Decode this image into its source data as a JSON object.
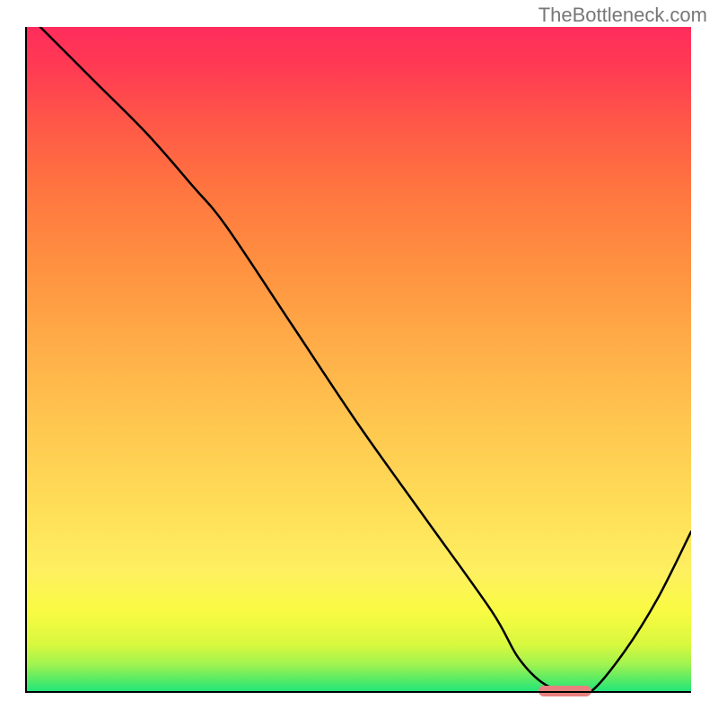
{
  "watermark": "TheBottleneck.com",
  "chart_data": {
    "type": "line",
    "title": "",
    "xlabel": "",
    "ylabel": "",
    "xlim": [
      0,
      100
    ],
    "ylim": [
      0,
      100
    ],
    "x": [
      2,
      10,
      18,
      25,
      30,
      40,
      50,
      60,
      70,
      74,
      78,
      82,
      85,
      90,
      95,
      100
    ],
    "values": [
      100,
      92,
      84,
      76,
      70,
      55,
      40,
      26,
      12,
      5,
      1,
      0,
      0,
      6,
      14,
      24
    ],
    "marker": {
      "x_start": 77,
      "x_end": 85,
      "y": 0
    },
    "gradient_top_color": "#ff2c5c",
    "gradient_bottom_color": "#23e67a"
  }
}
